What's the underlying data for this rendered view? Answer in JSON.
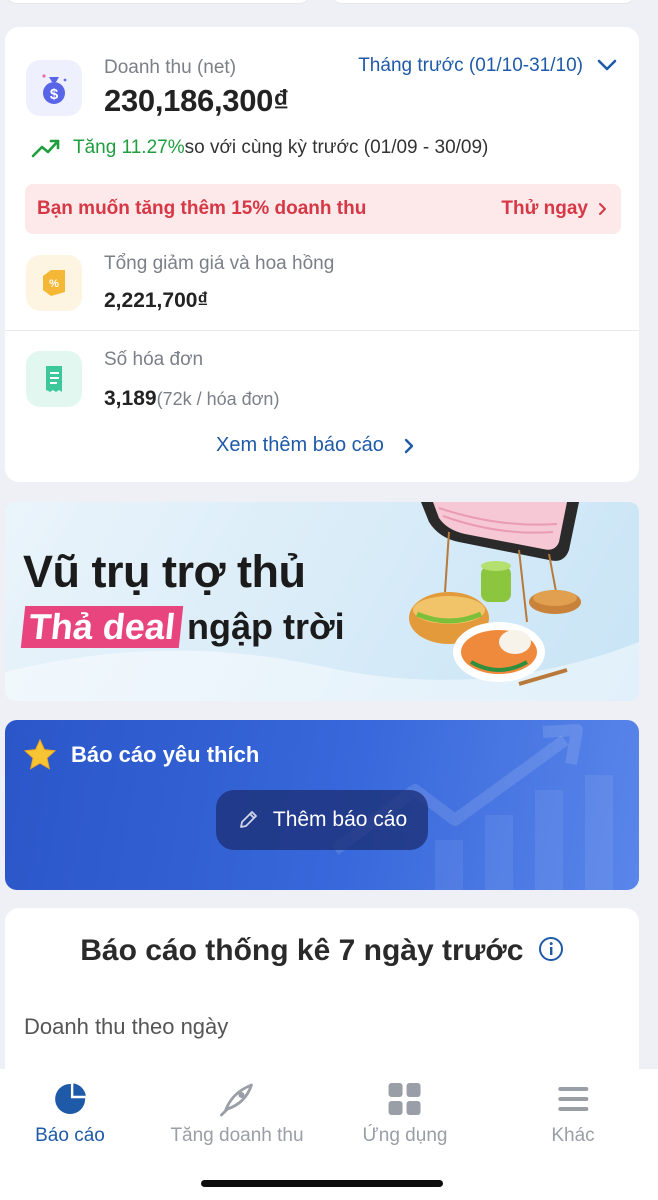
{
  "revenue": {
    "label": "Doanh thu (net)",
    "value": "230,186,300₫",
    "period": "Tháng trước (01/10-31/10)",
    "growth_value": "Tăng 11.27%",
    "growth_rest": " so với cùng kỳ trước (01/09 - 30/09)",
    "promo_text": "Bạn muốn tăng thêm 15% doanh thu",
    "promo_cta": "Thử ngay",
    "discount_label": "Tổng giảm giá và hoa hồng",
    "discount_value": "2,221,700₫",
    "invoice_label": "Số hóa đơn",
    "invoice_value": "3,189",
    "invoice_note": " (72k / hóa đơn)",
    "more_link": "Xem thêm báo cáo"
  },
  "banner": {
    "title": "Vũ trụ trợ thủ",
    "tag": "Thả deal",
    "rest": "ngập trời"
  },
  "favorites": {
    "title": "Báo cáo yêu thích",
    "add_label": "Thêm báo cáo"
  },
  "stats": {
    "title": "Báo cáo thống kê 7 ngày trước",
    "subtitle": "Doanh thu theo ngày"
  },
  "nav": {
    "items": [
      {
        "label": "Báo cáo",
        "icon": "pie-chart-icon",
        "active": true
      },
      {
        "label": "Tăng doanh thu",
        "icon": "rocket-icon",
        "active": false
      },
      {
        "label": "Ứng dụng",
        "icon": "grid-apps-icon",
        "active": false
      },
      {
        "label": "Khác",
        "icon": "hamburger-menu-icon",
        "active": false
      }
    ]
  },
  "colors": {
    "primary_blue": "#1f5aa8",
    "growth_green": "#1f9e3f",
    "promo_red": "#d63845",
    "promo_bg": "#fde8ea",
    "banner_pink": "#e8457f",
    "favorites_blue": "#2a56c8"
  }
}
